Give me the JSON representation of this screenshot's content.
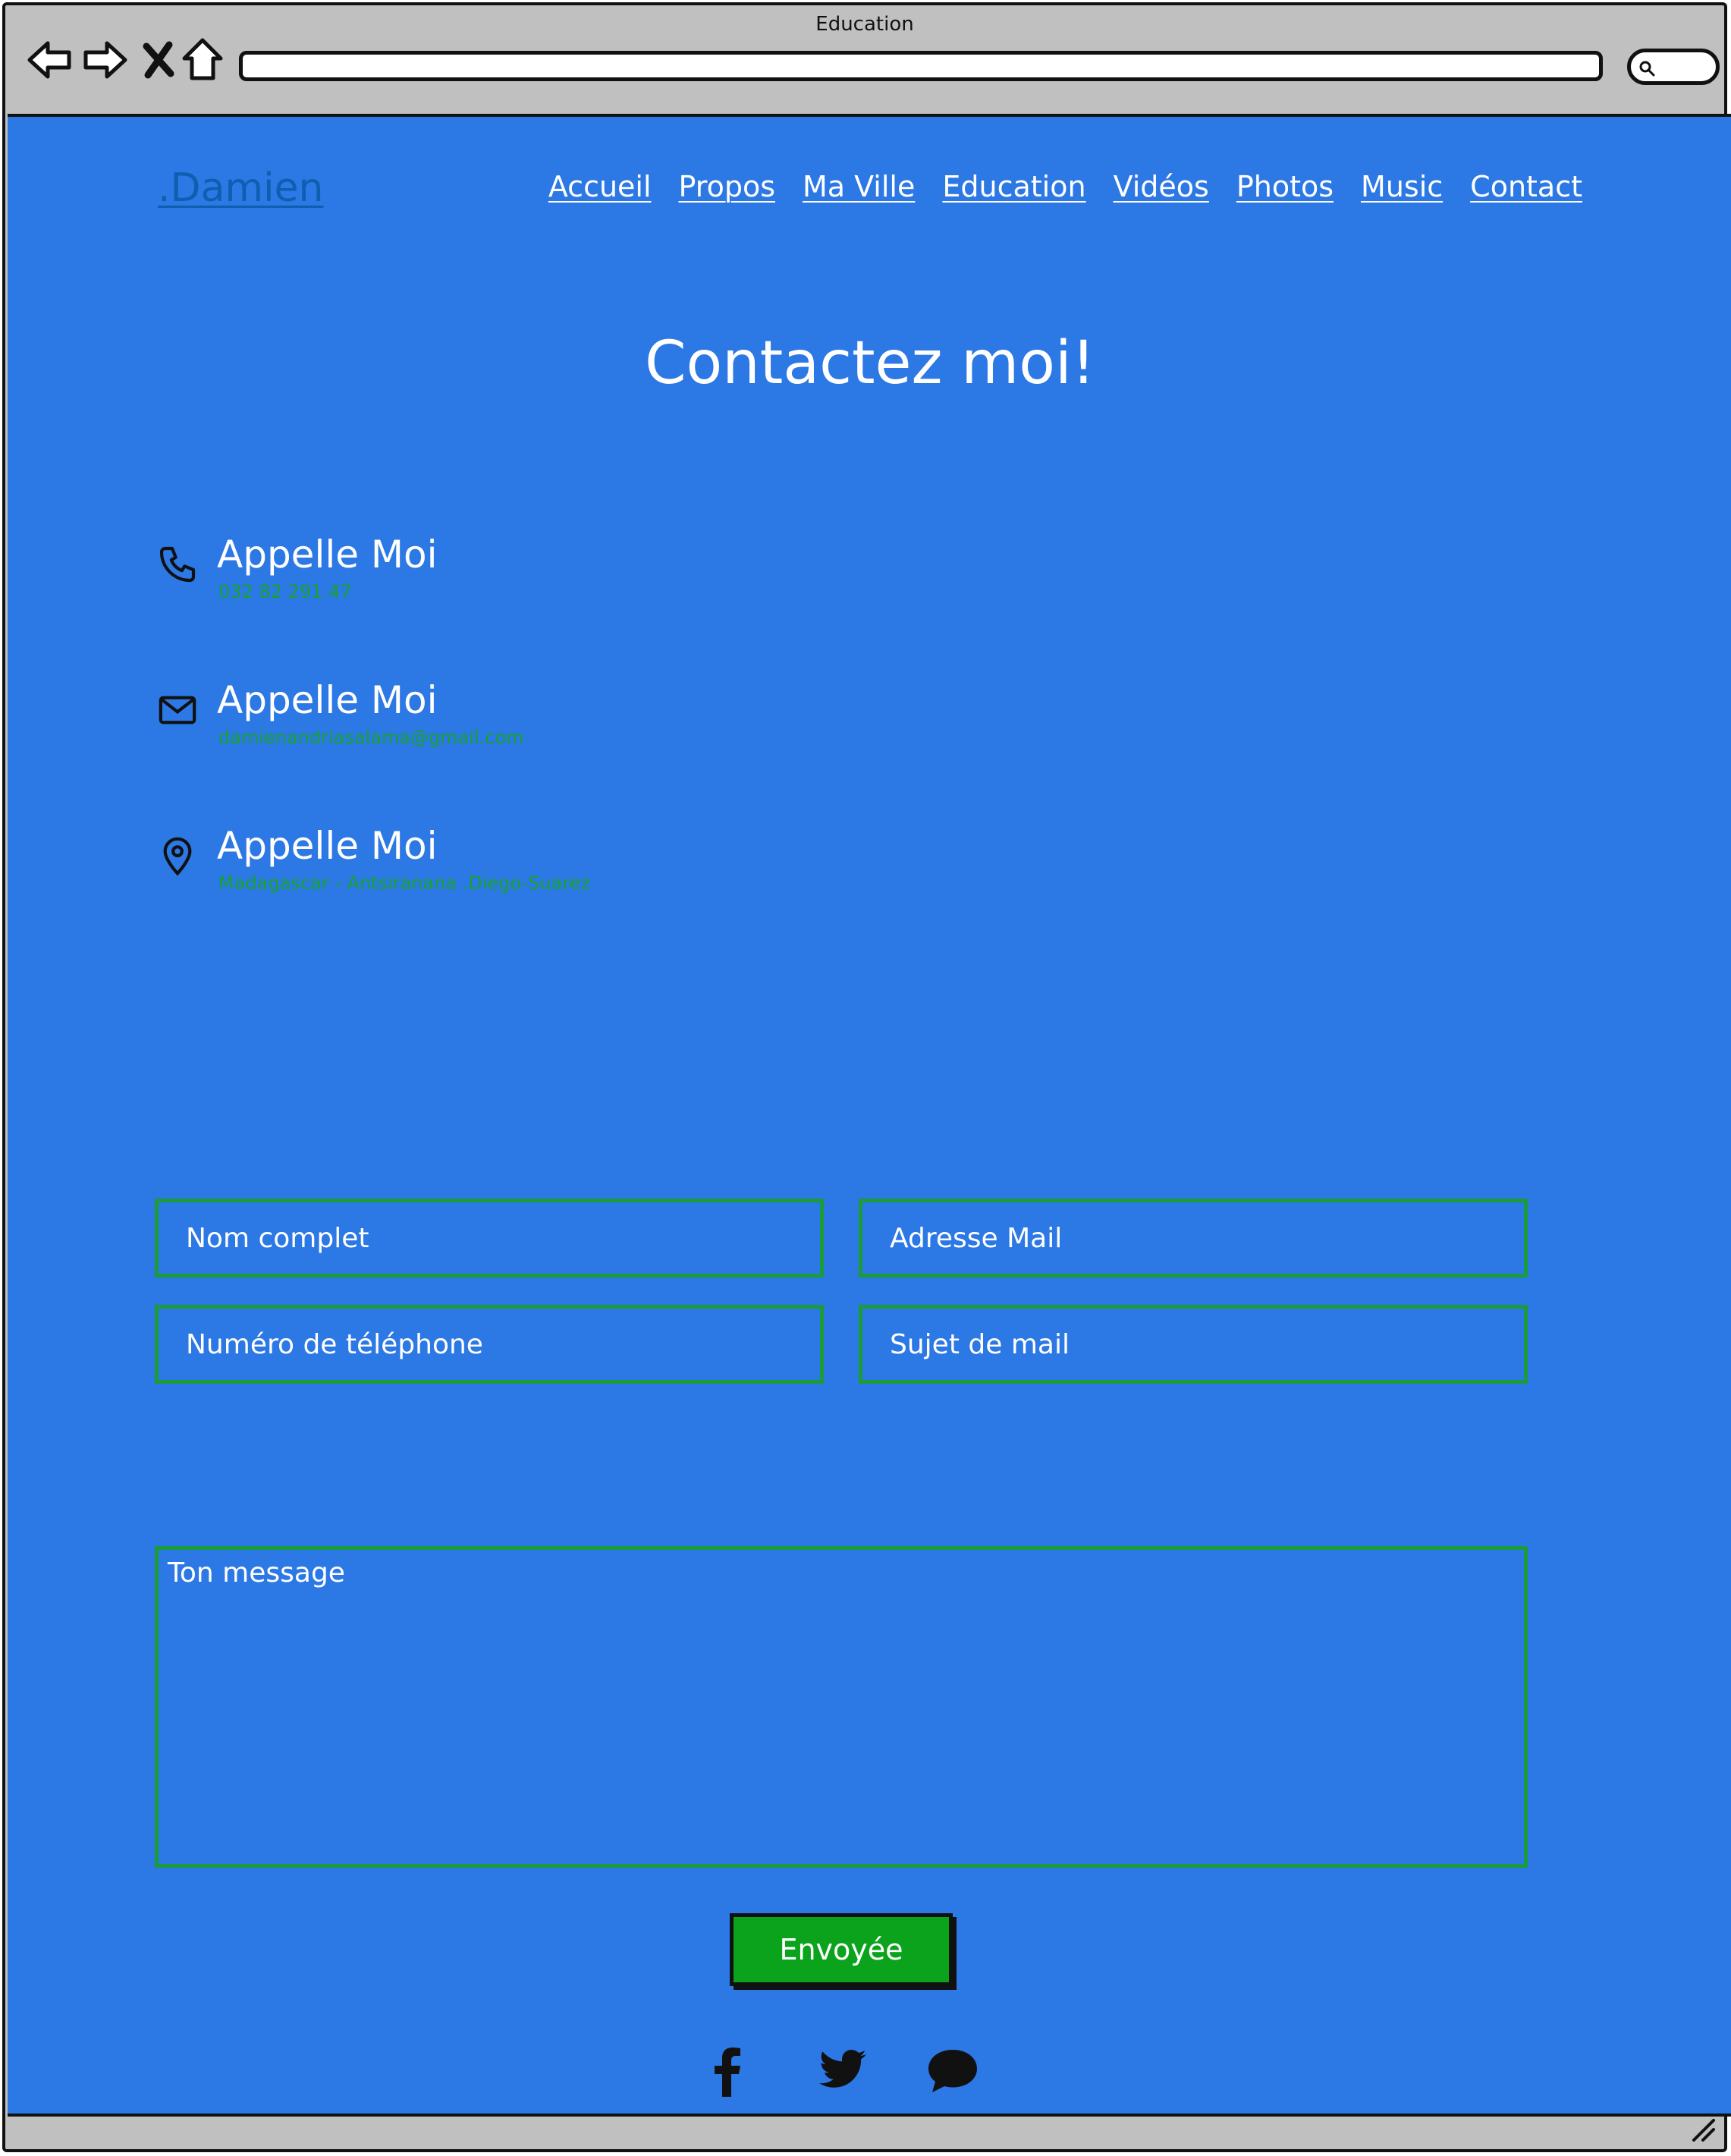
{
  "window": {
    "title": "Education"
  },
  "browser": {
    "back_icon": "arrow-left-icon",
    "forward_icon": "arrow-right-icon",
    "stop_icon": "close-icon",
    "home_icon": "home-icon",
    "search_icon": "search-icon"
  },
  "header": {
    "logo": ".Damien",
    "nav": [
      "Accueil",
      "Propos",
      "Ma Ville",
      "Education",
      "Vidéos",
      "Photos",
      "Music",
      "Contact"
    ]
  },
  "main": {
    "title": "Contactez moi!",
    "contacts": [
      {
        "icon": "phone-icon",
        "heading": "Appelle Moi",
        "value": "032 82 291 47"
      },
      {
        "icon": "mail-icon",
        "heading": "Appelle Moi",
        "value": "damienandriasalama@gmail.com"
      },
      {
        "icon": "location-pin-icon",
        "heading": "Appelle Moi",
        "value": "Madagascar - Antsiranana .Diego-Suarez"
      }
    ]
  },
  "form": {
    "name_placeholder": "Nom complet",
    "email_placeholder": "Adresse Mail",
    "phone_placeholder": "Numéro de téléphone",
    "subject_placeholder": "Sujet de mail",
    "message_placeholder": "Ton message",
    "submit_label": "Envoyée"
  },
  "social": [
    "facebook-icon",
    "twitter-icon",
    "chat-icon"
  ],
  "colors": {
    "page_background": "#2c78e4",
    "accent_green": "#0aa31b",
    "logo_blue": "#0d5fb0",
    "frame_gray": "#c0c0c0"
  }
}
